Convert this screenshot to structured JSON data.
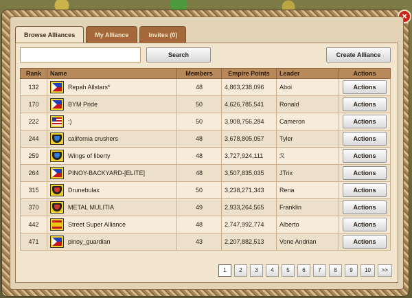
{
  "tabs": [
    {
      "label": "Browse Alliances"
    },
    {
      "label": "My Alliance"
    },
    {
      "label": "Invites (0)"
    }
  ],
  "search": {
    "placeholder": "",
    "value": "",
    "button_label": "Search"
  },
  "create_label": "Create Alliance",
  "columns": [
    "Rank",
    "Name",
    "Members",
    "Empire Points",
    "Leader",
    "Actions"
  ],
  "rows": [
    {
      "rank": "132",
      "flag": "philippines-flag",
      "name": "Repah Allstars*",
      "members": "48",
      "points": "4,863,238,096",
      "leader": "Aboi",
      "action": "Actions"
    },
    {
      "rank": "170",
      "flag": "philippines-flag",
      "name": "BYM Pride",
      "members": "50",
      "points": "4,626,785,541",
      "leader": "Ronald",
      "action": "Actions"
    },
    {
      "rank": "222",
      "flag": "usa-flag",
      "name": ":)",
      "members": "50",
      "points": "3,908,756,284",
      "leader": "Cameron",
      "action": "Actions"
    },
    {
      "rank": "244",
      "flag": "blue-shield-flag",
      "name": "california crushers",
      "members": "48",
      "points": "3,678,805,057",
      "leader": "Tyler",
      "action": "Actions"
    },
    {
      "rank": "259",
      "flag": "blue-shield-flag",
      "name": "Wings of liberty",
      "members": "48",
      "points": "3,727,924,111",
      "leader": "ℛ",
      "action": "Actions"
    },
    {
      "rank": "264",
      "flag": "philippines-flag",
      "name": "PINOY-BACKYARD-[ELITE]",
      "members": "48",
      "points": "3,507,835,035",
      "leader": "JTrix",
      "action": "Actions"
    },
    {
      "rank": "315",
      "flag": "red-shield-flag",
      "name": "Drunebulax",
      "members": "50",
      "points": "3,238,271,343",
      "leader": "Rena",
      "action": "Actions"
    },
    {
      "rank": "370",
      "flag": "red-shield-flag",
      "name": "METAL MULITIA",
      "members": "49",
      "points": "2,933,264,565",
      "leader": "Franklin",
      "action": "Actions"
    },
    {
      "rank": "442",
      "flag": "spain-flag",
      "name": "Street Super Alliance",
      "members": "48",
      "points": "2,747,992,774",
      "leader": "Alberto",
      "action": "Actions"
    },
    {
      "rank": "471",
      "flag": "philippines-flag",
      "name": "pinoy_guardian",
      "members": "43",
      "points": "2,207,882,513",
      "leader": "Vone Andrian",
      "action": "Actions"
    }
  ],
  "pagination": {
    "pages": [
      "1",
      "2",
      "3",
      "4",
      "5",
      "6",
      "7",
      "8",
      "9",
      "10"
    ],
    "current": "1",
    "next_label": ">>"
  },
  "close_label": "×"
}
